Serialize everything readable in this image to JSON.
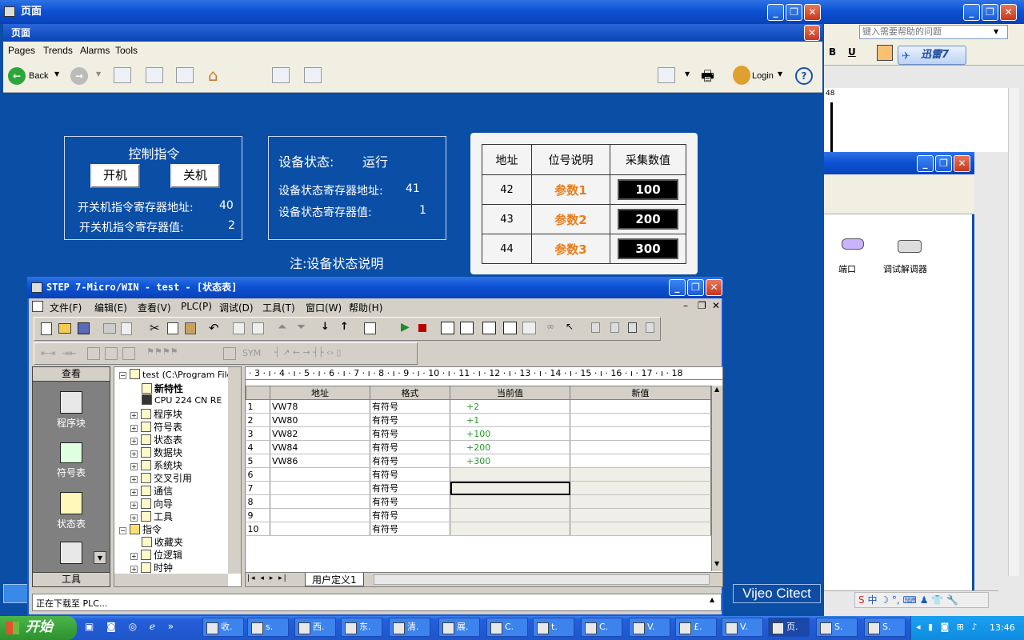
{
  "main_window": {
    "title": "页面",
    "inner_title": "页面",
    "menu": [
      "Pages",
      "Trends",
      "Alarms",
      "Tools"
    ],
    "back_label": "Back",
    "login_label": "Login"
  },
  "control": {
    "title": "控制指令",
    "on_button": "开机",
    "off_button": "关机",
    "addr_label": "开关机指令寄存器地址:",
    "addr_value": "40",
    "value_label": "开关机指令寄存器值:",
    "value_value": "2"
  },
  "status": {
    "label": "设备状态:",
    "value": "运行",
    "addr_label": "设备状态寄存器地址:",
    "addr_value": "41",
    "reg_label": "设备状态寄存器值:",
    "reg_value": "1",
    "note": "注:设备状态说明"
  },
  "param_table": {
    "headers": [
      "地址",
      "位号说明",
      "采集数值"
    ],
    "rows": [
      {
        "addr": "42",
        "name": "参数1",
        "value": "100"
      },
      {
        "addr": "43",
        "name": "参数2",
        "value": "200"
      },
      {
        "addr": "44",
        "name": "参数3",
        "value": "300"
      }
    ]
  },
  "help_box": {
    "placeholder": "键入需要帮助的问题",
    "num": "48"
  },
  "xunlei": "迅雷7",
  "devices": {
    "port": "端口",
    "modem": "调试解调器"
  },
  "vijeo": "Vijeo Citect",
  "step7": {
    "title": "STEP 7-Micro/WIN - test - [状态表]",
    "menu": [
      "文件(F)",
      "编辑(E)",
      "查看(V)",
      "PLC(P)",
      "调试(D)",
      "工具(T)",
      "窗口(W)",
      "帮助(H)"
    ],
    "view_header": "查看",
    "nav": [
      "程序块",
      "符号表",
      "状态表"
    ],
    "nav_footer": "工具",
    "tree": [
      {
        "label": "test (C:\\Program Files",
        "bold": false
      },
      {
        "label": "新特性",
        "bold": true
      },
      {
        "label": "CPU 224 CN RE",
        "bold": false
      },
      {
        "label": "程序块",
        "bold": false
      },
      {
        "label": "符号表",
        "bold": false
      },
      {
        "label": "状态表",
        "bold": false
      },
      {
        "label": "数据块",
        "bold": false
      },
      {
        "label": "系统块",
        "bold": false
      },
      {
        "label": "交叉引用",
        "bold": false
      },
      {
        "label": "通信",
        "bold": false
      },
      {
        "label": "向导",
        "bold": false
      },
      {
        "label": "工具",
        "bold": false
      },
      {
        "label": "指令",
        "bold": false
      },
      {
        "label": "收藏夹",
        "bold": false
      },
      {
        "label": "位逻辑",
        "bold": false
      },
      {
        "label": "时钟",
        "bold": false
      }
    ],
    "ruler": "· 3 · ı · 4 · ı · 5 · ı · 6 · ı · 7 · ı · 8 · ı · 9 · ı · 10 · ı · 11 · ı · 12 · ı · 13 · ı · 14 · ı · 15 · ı · 16 · ı · 17 · ı · 18",
    "columns": [
      "地址",
      "格式",
      "当前值",
      "新值"
    ],
    "rows": [
      {
        "n": "1",
        "addr": "VW78",
        "fmt": "有符号",
        "cur": "+2"
      },
      {
        "n": "2",
        "addr": "VW80",
        "fmt": "有符号",
        "cur": "+1"
      },
      {
        "n": "3",
        "addr": "VW82",
        "fmt": "有符号",
        "cur": "+100"
      },
      {
        "n": "4",
        "addr": "VW84",
        "fmt": "有符号",
        "cur": "+200"
      },
      {
        "n": "5",
        "addr": "VW86",
        "fmt": "有符号",
        "cur": "+300"
      },
      {
        "n": "6",
        "addr": "",
        "fmt": "有符号",
        "cur": ""
      },
      {
        "n": "7",
        "addr": "",
        "fmt": "有符号",
        "cur": ""
      },
      {
        "n": "8",
        "addr": "",
        "fmt": "有符号",
        "cur": ""
      },
      {
        "n": "9",
        "addr": "",
        "fmt": "有符号",
        "cur": ""
      },
      {
        "n": "10",
        "addr": "",
        "fmt": "有符号",
        "cur": ""
      }
    ],
    "tab": "用户定义1",
    "status_line": "正在下载至 PLC..."
  },
  "taskbar": {
    "start": "开始",
    "tasks": [
      "收.",
      "s.",
      "西.",
      "东.",
      "清.",
      "展.",
      "C.",
      "t.",
      "C.",
      "V.",
      "£.",
      "V.",
      "页.",
      "S.",
      "S."
    ],
    "clock": "13:46"
  }
}
